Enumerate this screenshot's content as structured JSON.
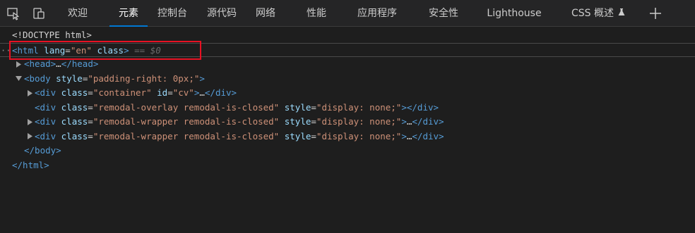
{
  "toolbar": {
    "icons": [
      "inspect-element-icon",
      "device-emulation-icon"
    ],
    "tabs": [
      {
        "label": "欢迎",
        "active": false
      },
      {
        "label": "元素",
        "active": true
      },
      {
        "label": "控制台",
        "active": false
      },
      {
        "label": "源代码",
        "active": false
      },
      {
        "label": "网络",
        "active": false
      },
      {
        "label": "性能",
        "active": false
      },
      {
        "label": "应用程序",
        "active": false
      },
      {
        "label": "安全性",
        "active": false
      },
      {
        "label": "Lighthouse",
        "active": false
      },
      {
        "label": "CSS 概述",
        "active": false,
        "icon": "beaker-icon"
      }
    ],
    "add_tab_icon": "plus-icon"
  },
  "colors": {
    "background": "#1e1e1e",
    "toolbar_bg": "#252526",
    "tag": "#569cd6",
    "attribute": "#9cdcfe",
    "value": "#ce9178",
    "active_tab_underline": "#0078d4",
    "highlight_box": "#e81123"
  },
  "dom_tree": {
    "doctype": "<!DOCTYPE html>",
    "html_open": {
      "tag_start": "<html",
      "attr1": "lang",
      "eq": "=",
      "val1": "\"en\"",
      "attr2": "class",
      "tag_end": ">",
      "console_ref": "== $0"
    },
    "head": {
      "tag_start": "<head>",
      "ellipsis": "…",
      "tag_end": "</head>"
    },
    "body_open": {
      "tag_start": "<body",
      "attr": "style",
      "eq": "=",
      "val": "\"padding-right: 0px;\"",
      "tag_end": ">"
    },
    "children": [
      {
        "tag_start": "<div",
        "attrs": [
          {
            "name": "class",
            "value": "\"container\""
          },
          {
            "name": "id",
            "value": "\"cv\""
          }
        ],
        "tag_end": ">",
        "ellipsis": "…",
        "close": "</div>",
        "expandable": true
      },
      {
        "tag_start": "<div",
        "attrs": [
          {
            "name": "class",
            "value": "\"remodal-overlay remodal-is-closed\""
          },
          {
            "name": "style",
            "value": "\"display: none;\""
          }
        ],
        "tag_end": ">",
        "ellipsis": "",
        "close": "</div>",
        "expandable": false
      },
      {
        "tag_start": "<div",
        "attrs": [
          {
            "name": "class",
            "value": "\"remodal-wrapper remodal-is-closed\""
          },
          {
            "name": "style",
            "value": "\"display: none;\""
          }
        ],
        "tag_end": ">",
        "ellipsis": "…",
        "close": "</div>",
        "expandable": true
      },
      {
        "tag_start": "<div",
        "attrs": [
          {
            "name": "class",
            "value": "\"remodal-wrapper remodal-is-closed\""
          },
          {
            "name": "style",
            "value": "\"display: none;\""
          }
        ],
        "tag_end": ">",
        "ellipsis": "…",
        "close": "</div>",
        "expandable": true
      }
    ],
    "body_close": "</body>",
    "html_close": "</html>",
    "row_dots": "··"
  }
}
